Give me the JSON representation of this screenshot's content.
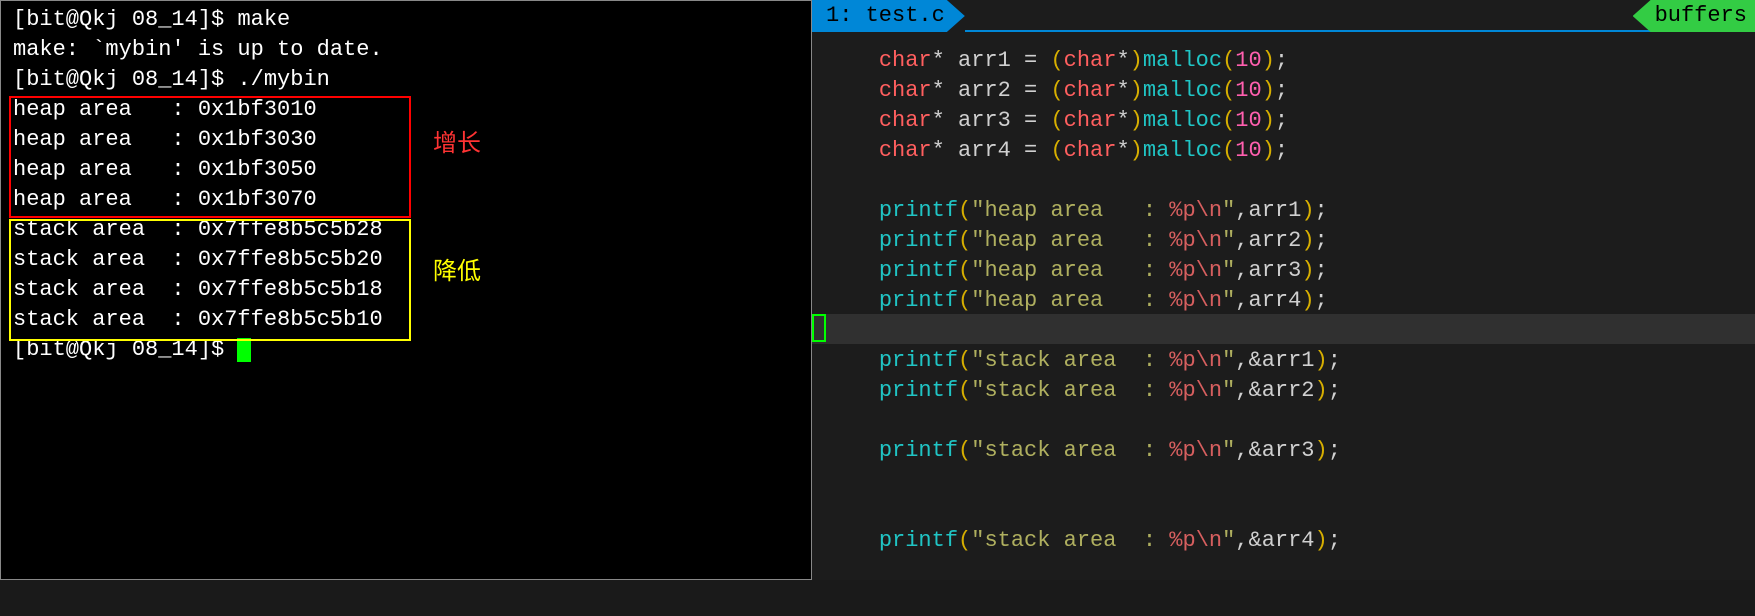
{
  "terminal": {
    "prompt1": "[bit@Qkj 08_14]$ ",
    "cmd1": "make",
    "output1": "make: `mybin' is up to date.",
    "prompt2": "[bit@Qkj 08_14]$ ",
    "cmd2": "./mybin",
    "heap_lines": [
      "heap area   : 0x1bf3010",
      "heap area   : 0x1bf3030",
      "heap area   : 0x1bf3050",
      "heap area   : 0x1bf3070"
    ],
    "stack_lines": [
      "stack area  : 0x7ffe8b5c5b28",
      "stack area  : 0x7ffe8b5c5b20",
      "stack area  : 0x7ffe8b5c5b18",
      "stack area  : 0x7ffe8b5c5b10"
    ],
    "prompt3": "[bit@Qkj 08_14]$ ",
    "annotation_grow": "增长",
    "annotation_decrease": "降低"
  },
  "editor": {
    "tab_label": "1: test.c",
    "buffers_label": "buffers",
    "code": {
      "decls": [
        {
          "var": "arr1",
          "arg": "10"
        },
        {
          "var": "arr2",
          "arg": "10"
        },
        {
          "var": "arr3",
          "arg": "10"
        },
        {
          "var": "arr4",
          "arg": "10"
        }
      ],
      "heap_prints": [
        {
          "label": "heap area   : ",
          "fmt": "%p",
          "esc": "\\n",
          "arg": "arr1"
        },
        {
          "label": "heap area   : ",
          "fmt": "%p",
          "esc": "\\n",
          "arg": "arr2"
        },
        {
          "label": "heap area   : ",
          "fmt": "%p",
          "esc": "\\n",
          "arg": "arr3"
        },
        {
          "label": "heap area   : ",
          "fmt": "%p",
          "esc": "\\n",
          "arg": "arr4"
        }
      ],
      "stack_prints": [
        {
          "label": "stack area  : ",
          "fmt": "%p",
          "esc": "\\n",
          "arg": "&arr1"
        },
        {
          "label": "stack area  : ",
          "fmt": "%p",
          "esc": "\\n",
          "arg": "&arr2"
        },
        {
          "label": "stack area  : ",
          "fmt": "%p",
          "esc": "\\n",
          "arg": "&arr3"
        },
        {
          "label": "stack area  : ",
          "fmt": "%p",
          "esc": "\\n",
          "arg": "&arr4"
        }
      ]
    }
  }
}
